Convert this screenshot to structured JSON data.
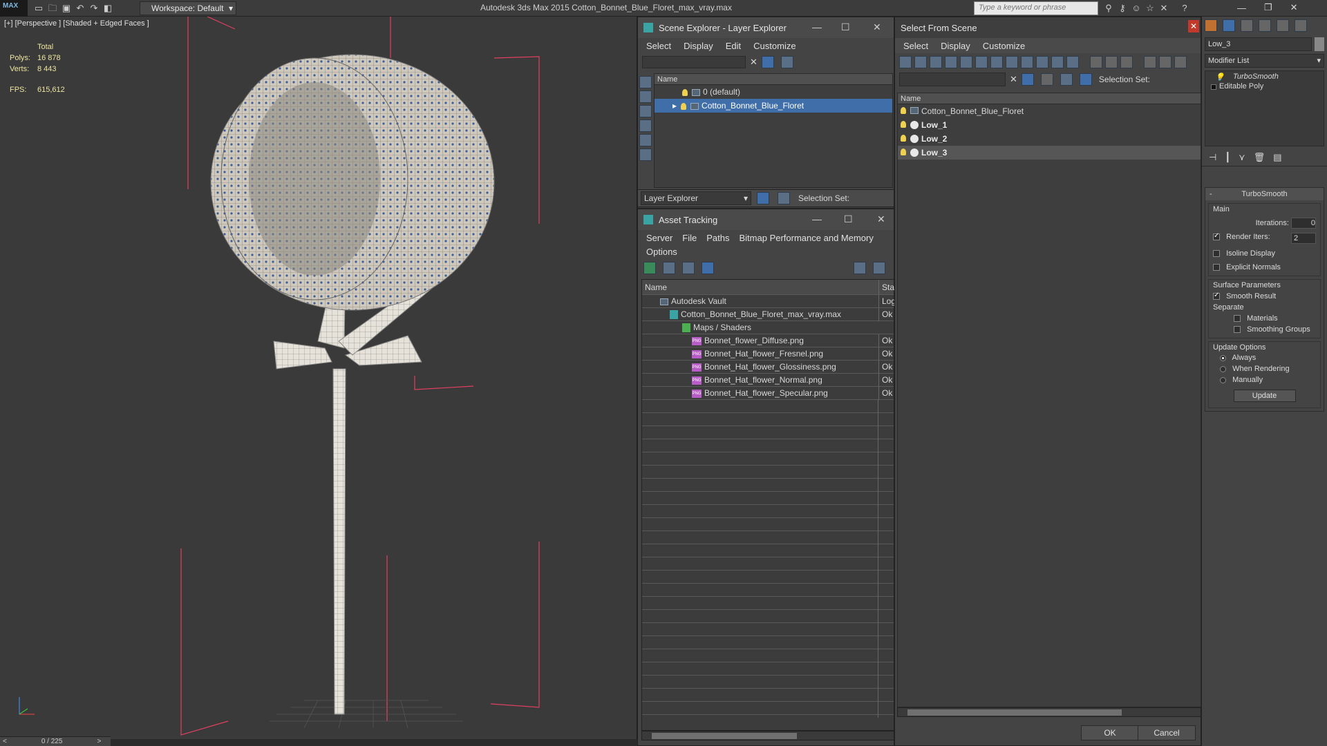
{
  "app": {
    "logo": "MAX",
    "workspace_label": "Workspace: Default",
    "title": "Autodesk 3ds Max  2015    Cotton_Bonnet_Blue_Floret_max_vray.max",
    "search_placeholder": "Type a keyword or phrase"
  },
  "viewport": {
    "label": "[+] [Perspective ] [Shaded + Edged Faces ]",
    "stats": {
      "total_label": "Total",
      "polys_label": "Polys:",
      "polys_value": "16 878",
      "verts_label": "Verts:",
      "verts_value": "8 443",
      "fps_label": "FPS:",
      "fps_value": "615,612"
    },
    "timeline": "0 / 225"
  },
  "scene_explorer": {
    "title": "Scene Explorer - Layer Explorer",
    "menu": [
      "Select",
      "Display",
      "Edit",
      "Customize"
    ],
    "column_name": "Name",
    "rows": [
      {
        "label": "0 (default)"
      },
      {
        "label": "Cotton_Bonnet_Blue_Floret"
      }
    ],
    "footer_dropdown": "Layer Explorer",
    "selection_set_label": "Selection Set:"
  },
  "asset_tracking": {
    "title": "Asset Tracking",
    "menu_row1": [
      "Server",
      "File",
      "Paths",
      "Bitmap Performance and Memory"
    ],
    "menu_row2": [
      "Options"
    ],
    "col_name": "Name",
    "col_status": "Stat",
    "rows": [
      {
        "name": "Autodesk Vault",
        "status": "Logi"
      },
      {
        "name": "Cotton_Bonnet_Blue_Floret_max_vray.max",
        "status": "Ok"
      },
      {
        "name": "Maps / Shaders",
        "status": ""
      },
      {
        "name": "Bonnet_flower_Diffuse.png",
        "status": "Ok"
      },
      {
        "name": "Bonnet_Hat_flower_Fresnel.png",
        "status": "Ok"
      },
      {
        "name": "Bonnet_Hat_flower_Glossiness.png",
        "status": "Ok"
      },
      {
        "name": "Bonnet_Hat_flower_Normal.png",
        "status": "Ok"
      },
      {
        "name": "Bonnet_Hat_flower_Specular.png",
        "status": "Ok"
      }
    ]
  },
  "select_from_scene": {
    "title": "Select From Scene",
    "menu": [
      "Select",
      "Display",
      "Customize"
    ],
    "selection_set_label": "Selection Set:",
    "column_name": "Name",
    "rows": [
      {
        "label": "Cotton_Bonnet_Blue_Floret"
      },
      {
        "label": "Low_1"
      },
      {
        "label": "Low_2"
      },
      {
        "label": "Low_3"
      }
    ],
    "ok_label": "OK",
    "cancel_label": "Cancel"
  },
  "command_panel": {
    "object_name": "Low_3",
    "modifier_list": "Modifier List",
    "stack": [
      "TurboSmooth",
      "Editable Poly"
    ],
    "rollout_title": "TurboSmooth",
    "main_label": "Main",
    "iterations_label": "Iterations:",
    "iterations_value": "0",
    "render_iters_label": "Render Iters:",
    "render_iters_value": "2",
    "isoline_label": "Isoline Display",
    "explicit_normals_label": "Explicit Normals",
    "surface_params_label": "Surface Parameters",
    "smooth_result_label": "Smooth Result",
    "separate_label": "Separate",
    "materials_label": "Materials",
    "smoothing_groups_label": "Smoothing Groups",
    "update_options_label": "Update Options",
    "always_label": "Always",
    "when_rendering_label": "When Rendering",
    "manually_label": "Manually",
    "update_button": "Update"
  },
  "colors": {
    "selection_blue": "#3f6ea8",
    "stats_yellow": "#f0e6a0",
    "bounding_box_red": "#e04060"
  }
}
